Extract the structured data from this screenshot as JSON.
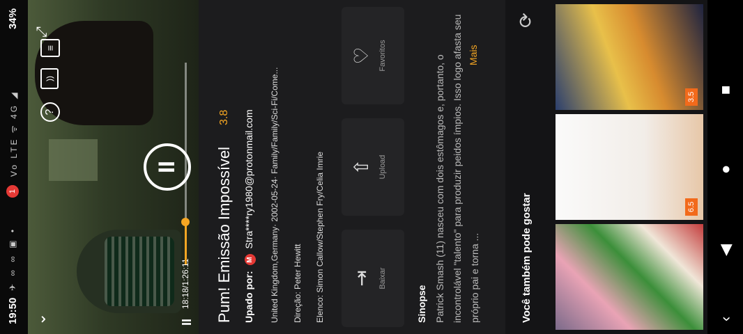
{
  "status": {
    "time": "19:50",
    "left_icons": "✈ ∞ ∞ ▣ •",
    "notification_count": "1",
    "right_icons": "Vo LTE ᯤ 4G ◢",
    "battery": "34%"
  },
  "player": {
    "pause_glyph": "II",
    "elapsed": "18:18",
    "duration": "1:26:11",
    "time_display": "18:18/1:26:11",
    "progress_fraction": 0.21,
    "accent": "#f5a623"
  },
  "movie": {
    "title": "Pum! Emissão Impossível",
    "rating": "3.8",
    "uploader_label": "Upado por:",
    "uploader_badge": "M",
    "uploader": "Stra****ry1980@protonmail.com",
    "meta": "United Kingdom,Germany·  2002-05-24·  Family/Family/Sci-Fi/Come...",
    "director": "Direção: Peter Hewitt",
    "cast": "Elenco: Simon Callow/Stephen Fry/Celia Imrie"
  },
  "actions": [
    {
      "label": "Baixar",
      "icon": "download-icon",
      "glyph": "⇥"
    },
    {
      "label": "Upload",
      "icon": "upload-cloud-icon",
      "glyph": "⇧"
    },
    {
      "label": "Favoritos",
      "icon": "heart-icon",
      "glyph": "♡"
    }
  ],
  "synopsis": {
    "heading": "Sinopse",
    "text": "Patrick Smash (11) nasceu com dois estômagos e, portanto, o incontrolável \"talento\" para produzir peidos ímpios. Isso logo afasta seu próprio pai e torna ...",
    "more": "Mais"
  },
  "recommendations": {
    "heading": "Você também pode gostar",
    "items": [
      {
        "rating": "3.5"
      },
      {
        "rating": "6.5"
      },
      {
        "rating": ""
      }
    ]
  },
  "nav": {
    "back": "‹",
    "triangle": "◀",
    "circle": "●",
    "square": "■"
  }
}
